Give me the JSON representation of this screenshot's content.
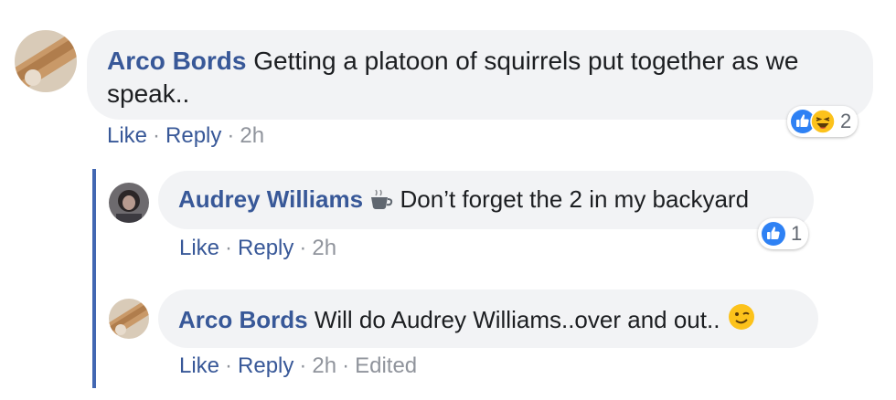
{
  "comments": [
    {
      "author": "Arco Bords",
      "text": "Getting a platoon of squirrels put together as we speak..",
      "actions": {
        "like": "Like",
        "reply": "Reply",
        "time": "2h"
      },
      "reactions": {
        "icons": [
          "like-icon",
          "haha-icon"
        ],
        "count": "2"
      }
    },
    {
      "author": "Audrey Williams",
      "author_badge": "coffee-cup-icon",
      "text": "Don’t forget the 2 in my backyard",
      "actions": {
        "like": "Like",
        "reply": "Reply",
        "time": "2h"
      },
      "reactions": {
        "icons": [
          "like-icon"
        ],
        "count": "1"
      }
    },
    {
      "author": "Arco Bords",
      "text": "Will do Audrey Williams..over and out..",
      "trailing_emoji": "wink-face-icon",
      "actions": {
        "like": "Like",
        "reply": "Reply",
        "time": "2h",
        "edited": "Edited"
      }
    }
  ],
  "separator": "·",
  "colors": {
    "author_link": "#385898",
    "bubble_bg": "#f2f3f5",
    "meta_text": "#90949c",
    "thread_line": "#4267b2",
    "like_blue": "#2e81f4",
    "emoji_yellow": "#fcc21b"
  }
}
